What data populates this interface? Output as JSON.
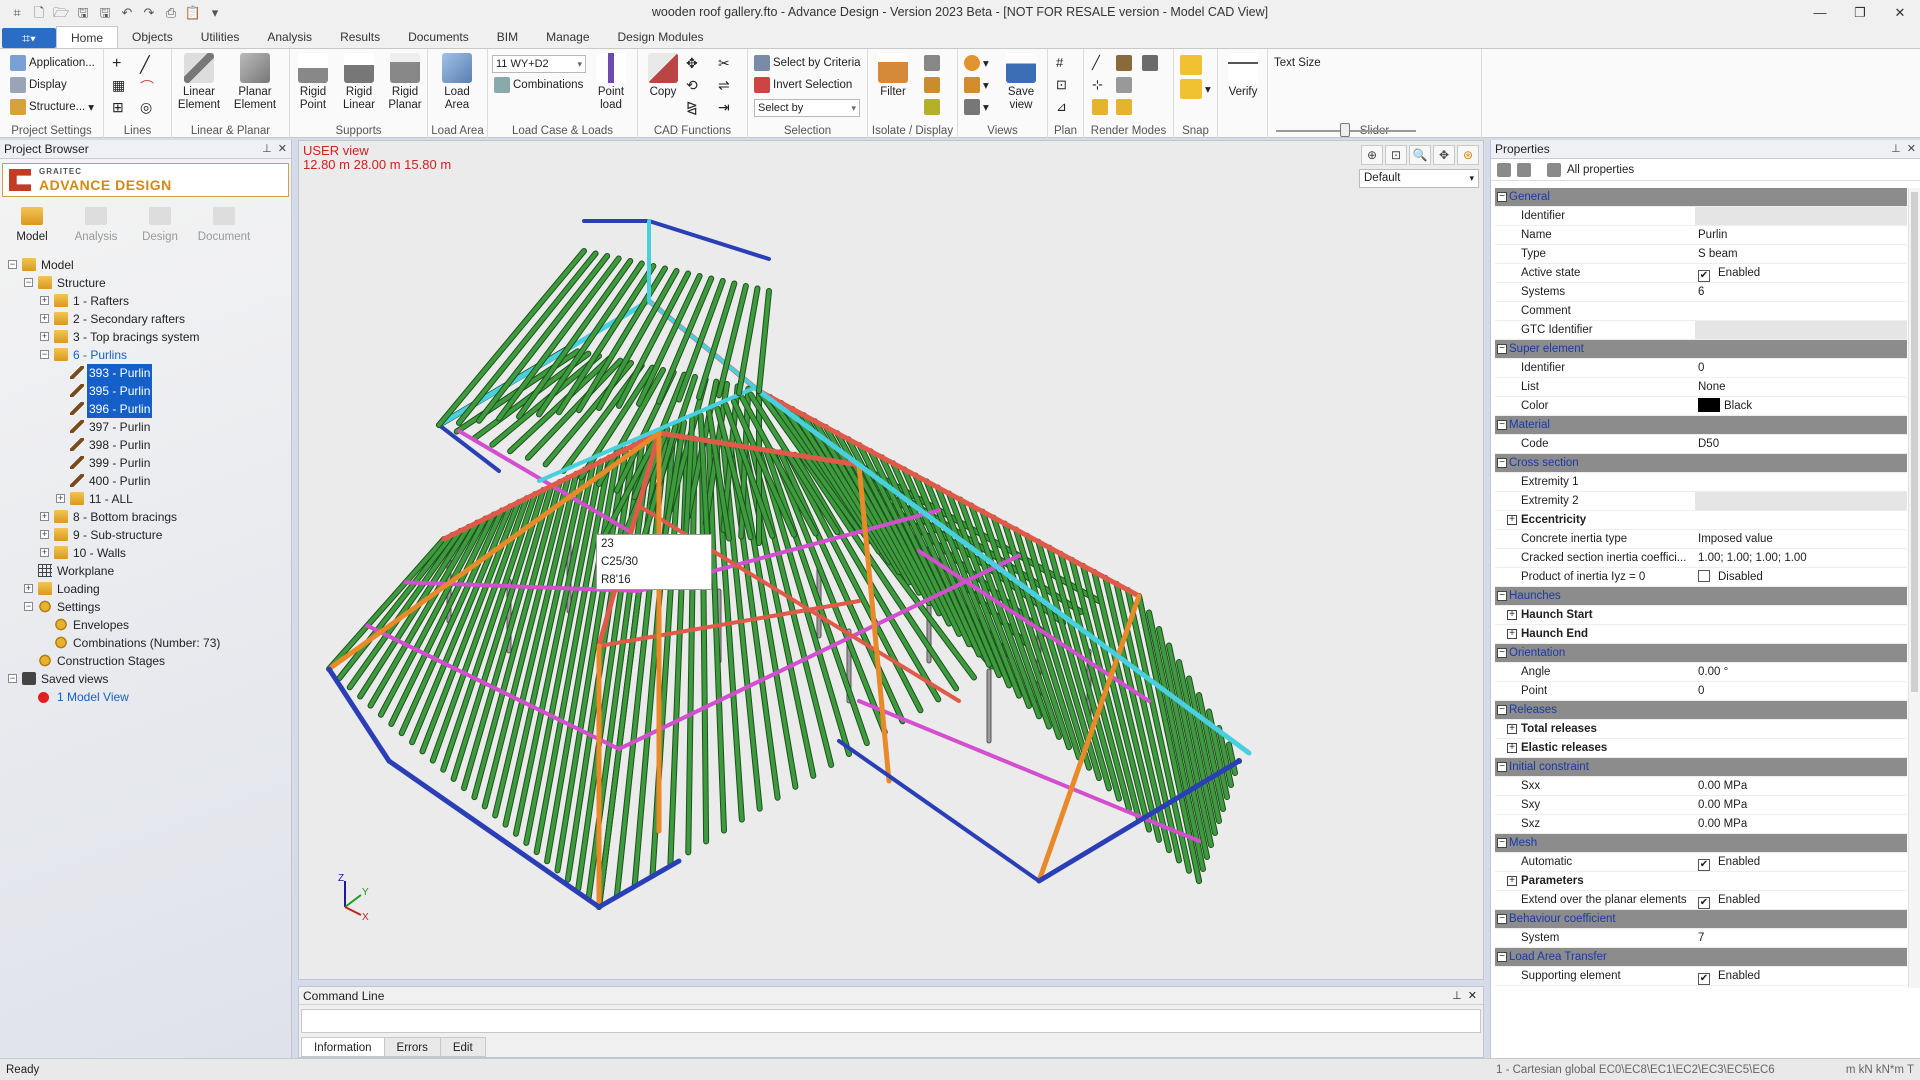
{
  "window": {
    "title": "wooden roof gallery.fto - Advance Design - Version 2023 Beta - [NOT FOR RESALE version - Model CAD View]"
  },
  "ribbon": {
    "tabs": [
      "Home",
      "Objects",
      "Utilities",
      "Analysis",
      "Results",
      "Documents",
      "BIM",
      "Manage",
      "Design Modules"
    ],
    "active_tab": "Home",
    "project_settings": {
      "application": "Application...",
      "display": "Display",
      "structure": "Structure...",
      "label": "Project Settings"
    },
    "lines": {
      "label": "Lines"
    },
    "linear_planar": {
      "linear": "Linear Element",
      "planar": "Planar Element",
      "label": "Linear & Planar"
    },
    "supports": {
      "rigid_point": "Rigid Point",
      "rigid_linear": "Rigid Linear",
      "rigid_planar": "Rigid Planar",
      "label": "Supports"
    },
    "load_area": {
      "btn": "Load Area",
      "label": "Load Area"
    },
    "load_case": {
      "combo": "11 WY+D2",
      "combinations": "Combinations",
      "point_load": "Point load",
      "label": "Load Case & Loads"
    },
    "cad": {
      "copy": "Copy",
      "label": "CAD Functions"
    },
    "selection": {
      "by_criteria": "Select by Criteria",
      "invert": "Invert Selection",
      "select_by": "Select by",
      "label": "Selection"
    },
    "isolate": {
      "filter": "Filter",
      "label": "Isolate / Display"
    },
    "views": {
      "save_view": "Save view",
      "label": "Views"
    },
    "plan": {
      "label": "Plan"
    },
    "render": {
      "label": "Render Modes"
    },
    "snap": {
      "label": "Snap"
    },
    "verify": {
      "btn": "Verify"
    },
    "slider": {
      "text_size": "Text Size",
      "label": "Slider"
    }
  },
  "project_browser": {
    "title": "Project Browser",
    "logo_top": "GRAITEC",
    "logo_main": "ADVANCE DESIGN",
    "tabs": [
      "Model",
      "Analysis",
      "Design",
      "Document"
    ],
    "tree": [
      {
        "label": "Model",
        "level": 0,
        "exp": "−",
        "icon": "folder"
      },
      {
        "label": "Structure",
        "level": 1,
        "exp": "−",
        "icon": "folder"
      },
      {
        "label": "1 - Rafters",
        "level": 2,
        "exp": "+",
        "icon": "folder"
      },
      {
        "label": "2 - Secondary rafters",
        "level": 2,
        "exp": "+",
        "icon": "folder"
      },
      {
        "label": "3 - Top bracings system",
        "level": 2,
        "exp": "+",
        "icon": "folder"
      },
      {
        "label": "6 - Purlins",
        "level": 2,
        "exp": "−",
        "icon": "folder",
        "style": "link"
      },
      {
        "label": "393 - Purlin",
        "level": 3,
        "icon": "beam",
        "style": "sel"
      },
      {
        "label": "395 - Purlin",
        "level": 3,
        "icon": "beam",
        "style": "sel"
      },
      {
        "label": "396 - Purlin",
        "level": 3,
        "icon": "beam",
        "style": "sel"
      },
      {
        "label": "397 - Purlin",
        "level": 3,
        "icon": "beam"
      },
      {
        "label": "398 - Purlin",
        "level": 3,
        "icon": "beam"
      },
      {
        "label": "399 - Purlin",
        "level": 3,
        "icon": "beam"
      },
      {
        "label": "400 - Purlin",
        "level": 3,
        "icon": "beam"
      },
      {
        "label": "11 - ALL",
        "level": 3,
        "exp": "+",
        "icon": "folder"
      },
      {
        "label": "8 - Bottom bracings",
        "level": 2,
        "exp": "+",
        "icon": "folder"
      },
      {
        "label": "9 - Sub-structure",
        "level": 2,
        "exp": "+",
        "icon": "folder"
      },
      {
        "label": "10 - Walls",
        "level": 2,
        "exp": "+",
        "icon": "folder"
      },
      {
        "label": "Workplane",
        "level": 1,
        "icon": "grid"
      },
      {
        "label": "Loading",
        "level": 1,
        "exp": "+",
        "icon": "folder"
      },
      {
        "label": "Settings",
        "level": 1,
        "exp": "−",
        "icon": "gear"
      },
      {
        "label": "Envelopes",
        "level": 2,
        "icon": "gear"
      },
      {
        "label": "Combinations (Number: 73)",
        "level": 2,
        "icon": "gear"
      },
      {
        "label": "Construction Stages",
        "level": 1,
        "icon": "gear"
      },
      {
        "label": "Saved views",
        "level": 0,
        "exp": "−",
        "icon": "view"
      },
      {
        "label": "1 Model View",
        "level": 1,
        "icon": "dot",
        "style": "link"
      }
    ]
  },
  "viewport": {
    "view_name": "USER view",
    "dimensions": "12.80 m  28.00 m  15.80 m",
    "display_combo": "Default",
    "tooltip": [
      "23",
      "C25/30",
      "R8'16"
    ],
    "axes": {
      "x": "X",
      "y": "Y",
      "z": "Z"
    }
  },
  "command_line": {
    "title": "Command Line",
    "tabs": [
      "Information",
      "Errors",
      "Edit"
    ]
  },
  "properties": {
    "title": "Properties",
    "filter": "All properties",
    "rows": [
      {
        "t": "sec",
        "name": "General"
      },
      {
        "t": "row",
        "name": "Identifier",
        "val": "",
        "grey": true
      },
      {
        "t": "row",
        "name": "Name",
        "val": "Purlin"
      },
      {
        "t": "row",
        "name": "Type",
        "val": "S beam"
      },
      {
        "t": "row",
        "name": "Active state",
        "val": "Enabled",
        "chk": true
      },
      {
        "t": "row",
        "name": "Systems",
        "val": "6"
      },
      {
        "t": "row",
        "name": "Comment",
        "val": ""
      },
      {
        "t": "row",
        "name": "GTC Identifier",
        "val": "",
        "grey": true
      },
      {
        "t": "sec",
        "name": "Super element"
      },
      {
        "t": "row",
        "name": "Identifier",
        "val": "0"
      },
      {
        "t": "row",
        "name": "List",
        "val": "None"
      },
      {
        "t": "row",
        "name": "Color",
        "val": "Black",
        "swatch": "#000000"
      },
      {
        "t": "sec",
        "name": "Material"
      },
      {
        "t": "row",
        "name": "Code",
        "val": "D50"
      },
      {
        "t": "sec",
        "name": "Cross section"
      },
      {
        "t": "row",
        "name": "Extremity 1",
        "val": ""
      },
      {
        "t": "row",
        "name": "Extremity 2",
        "val": "",
        "grey": true
      },
      {
        "t": "sub",
        "name": "Eccentricity"
      },
      {
        "t": "row",
        "name": "Concrete inertia type",
        "val": "Imposed value"
      },
      {
        "t": "row",
        "name": "Cracked section inertia coeffici...",
        "val": "1.00; 1.00; 1.00; 1.00"
      },
      {
        "t": "row",
        "name": "Product of inertia Iyz = 0",
        "val": "Disabled",
        "chk": false
      },
      {
        "t": "sec",
        "name": "Haunches"
      },
      {
        "t": "sub",
        "name": "Haunch Start"
      },
      {
        "t": "sub",
        "name": "Haunch End"
      },
      {
        "t": "sec",
        "name": "Orientation"
      },
      {
        "t": "row",
        "name": "Angle",
        "val": "0.00 °"
      },
      {
        "t": "row",
        "name": "Point",
        "val": "0"
      },
      {
        "t": "sec",
        "name": "Releases"
      },
      {
        "t": "sub",
        "name": "Total releases"
      },
      {
        "t": "sub",
        "name": "Elastic releases"
      },
      {
        "t": "sec",
        "name": "Initial constraint"
      },
      {
        "t": "row",
        "name": "Sxx",
        "val": "0.00 MPa"
      },
      {
        "t": "row",
        "name": "Sxy",
        "val": "0.00 MPa"
      },
      {
        "t": "row",
        "name": "Sxz",
        "val": "0.00 MPa"
      },
      {
        "t": "sec",
        "name": "Mesh"
      },
      {
        "t": "row",
        "name": "Automatic",
        "val": "Enabled",
        "chk": true
      },
      {
        "t": "sub",
        "name": "Parameters"
      },
      {
        "t": "row",
        "name": "Extend over the planar elements",
        "val": "Enabled",
        "chk": true
      },
      {
        "t": "sec",
        "name": "Behaviour coefficient"
      },
      {
        "t": "row",
        "name": "System",
        "val": "7"
      },
      {
        "t": "sec",
        "name": "Load Area Transfer"
      },
      {
        "t": "row",
        "name": "Supporting element",
        "val": "Enabled",
        "chk": true
      }
    ]
  },
  "status": {
    "ready": "Ready",
    "coord_system": "1 - Cartesian global  EC0\\EC8\\EC1\\EC2\\EC3\\EC5\\EC6",
    "units": "m  kN  kN*m  T"
  },
  "colors": {
    "rafters": "#3d9b3d",
    "ridge": "#e05a4a",
    "purlins": "#d34fcf",
    "hip": "#e8892a",
    "edge": "#48d0e0",
    "bracing": "#2a3fb5",
    "selected_tree": "#1460c8",
    "view_label": "#d21f1f"
  }
}
